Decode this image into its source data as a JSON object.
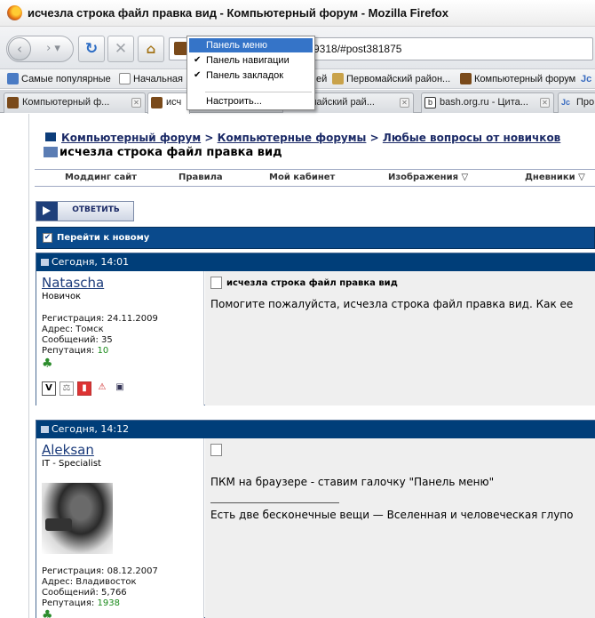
{
  "window": {
    "title": "исчезла строка файл правка вид - Компьютерный форум - Mozilla Firefox"
  },
  "navbar": {
    "url": "t39318/#post381875"
  },
  "bookmarks": [
    {
      "label": "Самые популярные"
    },
    {
      "label": "Начальная"
    },
    {
      "label": "ей"
    },
    {
      "label": "Первомайский район..."
    },
    {
      "label": "Компьютерный форум"
    },
    {
      "label": "Jc"
    }
  ],
  "tabs": [
    {
      "label": "Компьютерный ф...",
      "active": false
    },
    {
      "label": "исч",
      "active": true
    },
    {
      "label": "рвомайский рай...",
      "active": false
    },
    {
      "label": "bash.org.ru - Цита...",
      "active": false
    },
    {
      "label": "Про",
      "active": false
    }
  ],
  "context_menu": {
    "items": [
      {
        "label": "Панель меню",
        "checked": false,
        "highlighted": true
      },
      {
        "label": "Панель навигации",
        "checked": true,
        "highlighted": false
      },
      {
        "label": "Панель закладок",
        "checked": true,
        "highlighted": false
      },
      {
        "label": "Настроить...",
        "checked": false,
        "highlighted": false
      }
    ]
  },
  "breadcrumb": {
    "link1": "Компьютерный форум",
    "link2": "Компьютерные форумы",
    "link3": "Любые вопросы от новичков",
    "separator": ">",
    "thread_title": "исчезла строка файл правка вид"
  },
  "forum_nav": {
    "items": [
      "Моддинг сайт",
      "Правила",
      "Мой кабинет",
      "Изображения ▽",
      "Дневники ▽"
    ]
  },
  "reply_button": {
    "label": "ОТВЕТИТЬ"
  },
  "goto_new": {
    "label": "Перейти к новому"
  },
  "posts": [
    {
      "date": "Сегодня, 14:01",
      "author": "Natascha",
      "rank": "Новичок",
      "registration": "Регистрация: 24.11.2009",
      "address": "Адрес: Томск",
      "messages": "Сообщений: 35",
      "reputation_label": "Репутация:",
      "reputation_value": "10",
      "title": "исчезла строка файл правка вид",
      "body": "Помогите пожалуйста, исчезла строка файл правка вид. Как ее"
    },
    {
      "date": "Сегодня, 14:12",
      "author": "Aleksan",
      "rank": "IT - Specialist",
      "registration": "Регистрация: 08.12.2007",
      "address": "Адрес: Владивосток",
      "messages": "Сообщений: 5,766",
      "reputation_label": "Репутация:",
      "reputation_value": "1938",
      "body": "ПКМ на браузере - ставим галочку \"Панель меню\"",
      "signature": "Есть две бесконечные вещи — Вселенная и человеческая глупо"
    }
  ],
  "colors": {
    "post_header": "#003e79",
    "link": "#1b2a66",
    "menu_highlight": "#3574c8",
    "reputation": "#1a8a1a"
  }
}
